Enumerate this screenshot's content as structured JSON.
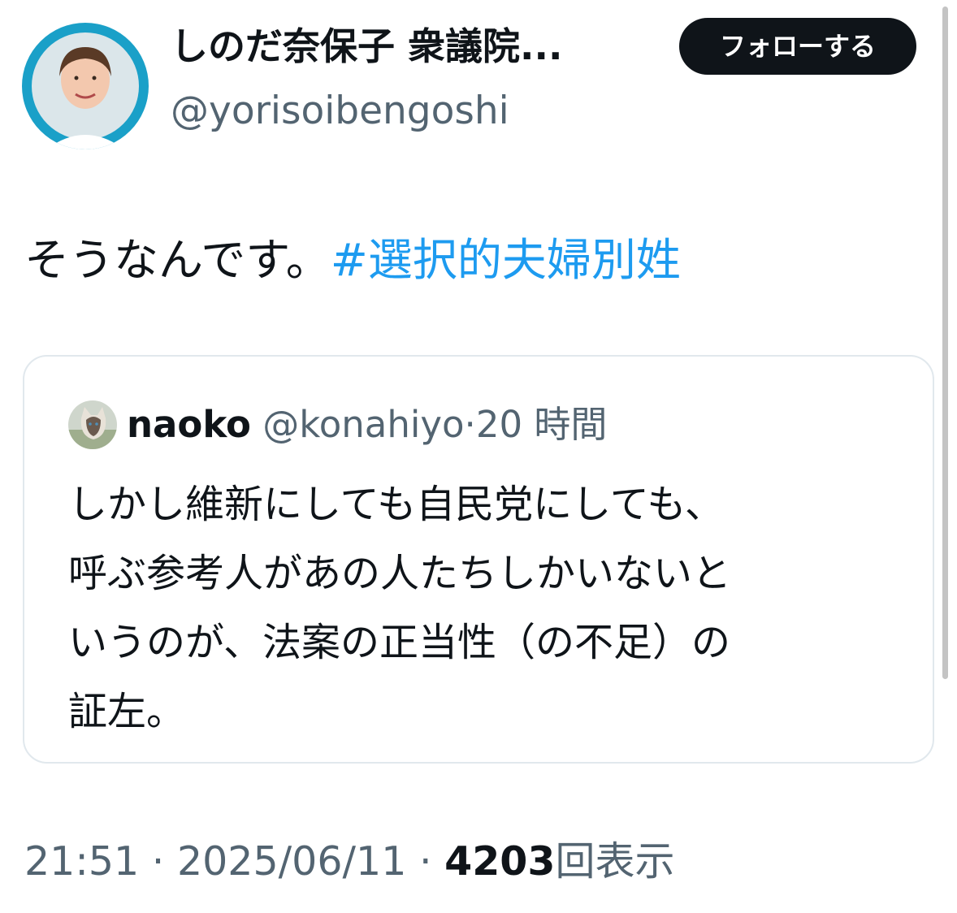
{
  "author": {
    "display_name": "しのだ奈保子 衆議院...",
    "handle": "@yorisoibengoshi",
    "follow_label": "フォローする"
  },
  "tweet": {
    "text": "そうなんです。",
    "hashtag": "#選択的夫婦別姓"
  },
  "quoted": {
    "name": "naoko",
    "handle": "@konahiyo",
    "separator": "·",
    "time": "20 時間",
    "lines": [
      "しかし維新にしても自民党にしても、",
      "呼ぶ参考人があの人たちしかいないと",
      "いうのが、法案の正当性（の不足）の",
      "証左。"
    ]
  },
  "meta": {
    "time": "21:51",
    "sep1": "·",
    "date": "2025/06/11",
    "sep2": "·",
    "views": "4203",
    "views_label": "回表示"
  },
  "colors": {
    "link": "#1d9bf0",
    "text": "#0f1419",
    "muted": "#536471",
    "avatar_ring": "#1aa0c8"
  }
}
